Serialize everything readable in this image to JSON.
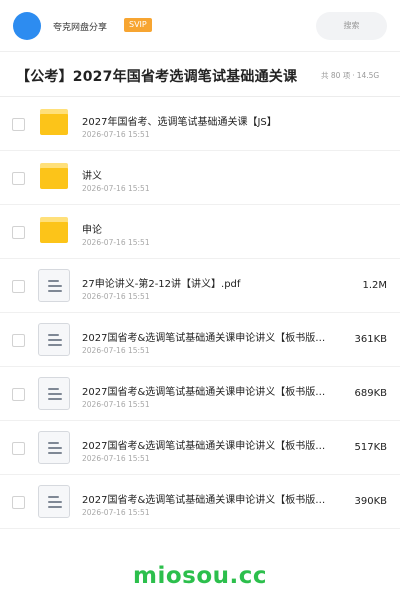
{
  "header": {
    "share_name": "夸克网盘分享",
    "svip": "SVIP",
    "search_placeholder": "搜索",
    "avatar_color": "#2d8cf0"
  },
  "title": {
    "text": "【公考】2027年国省考选调笔试基础通关课",
    "count": "共 80 项",
    "separator": "·",
    "size": "14.5G"
  },
  "files": [
    {
      "type": "folder",
      "icon": "folder-icon",
      "name": "2027年国省考、选调笔试基础通关课【JS】",
      "date": "2026-07-16 15:51",
      "size": ""
    },
    {
      "type": "folder",
      "icon": "folder-icon",
      "name": "讲义",
      "date": "2026-07-16 15:51",
      "size": ""
    },
    {
      "type": "folder",
      "icon": "folder-icon",
      "name": "申论",
      "date": "2026-07-16 15:51",
      "size": ""
    },
    {
      "type": "doc",
      "icon": "document-icon",
      "name": "27申论讲义-第2-12讲【讲义】.pdf",
      "date": "2026-07-16 15:51",
      "size": "1.2M"
    },
    {
      "type": "doc",
      "icon": "document-icon",
      "name": "2027国省考&选调笔试基础通关课申论讲义【板书版…",
      "date": "2026-07-16 15:51",
      "size": "361KB"
    },
    {
      "type": "doc",
      "icon": "document-icon",
      "name": "2027国省考&选调笔试基础通关课申论讲义【板书版…",
      "date": "2026-07-16 15:51",
      "size": "689KB"
    },
    {
      "type": "doc",
      "icon": "document-icon",
      "name": "2027国省考&选调笔试基础通关课申论讲义【板书版…",
      "date": "2026-07-16 15:51",
      "size": "517KB"
    },
    {
      "type": "doc",
      "icon": "document-icon",
      "name": "2027国省考&选调笔试基础通关课申论讲义【板书版…",
      "date": "2026-07-16 15:51",
      "size": "390KB"
    }
  ],
  "watermark": {
    "text": "miosou.cc",
    "color": "#2cbf4c"
  }
}
